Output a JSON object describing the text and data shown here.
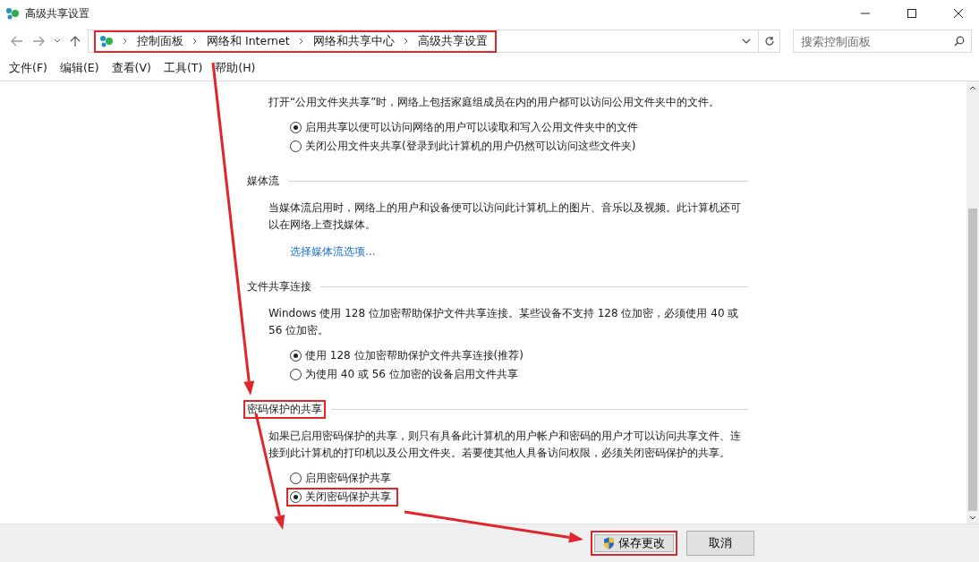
{
  "window": {
    "title": "高级共享设置"
  },
  "address_bar": {
    "highlighted": true,
    "crumbs": [
      "控制面板",
      "网络和 Internet",
      "网络和共享中心",
      "高级共享设置"
    ]
  },
  "search": {
    "placeholder": "搜索控制面板"
  },
  "menu": [
    "文件(F)",
    "编辑(E)",
    "查看(V)",
    "工具(T)",
    "帮助(H)"
  ],
  "sections": [
    {
      "items": [
        {
          "kind": "text",
          "text": "打开“公用文件夹共享”时，网络上包括家庭组成员在内的用户都可以访问公用文件夹中的文件。"
        },
        {
          "kind": "radio",
          "label": "启用共享以便可以访问网络的用户可以读取和写入公用文件夹中的文件",
          "selected": true,
          "highlighted": false
        },
        {
          "kind": "radio",
          "label": "关闭公用文件夹共享(登录到此计算机的用户仍然可以访问这些文件夹)",
          "selected": false,
          "highlighted": false
        }
      ]
    },
    {
      "heading": "媒体流",
      "heading_highlighted": false,
      "items": [
        {
          "kind": "text",
          "text": "当媒体流启用时，网络上的用户和设备便可以访问此计算机上的图片、音乐以及视频。此计算机还可以在网络上查找媒体。"
        },
        {
          "kind": "link",
          "text": "选择媒体流选项..."
        }
      ]
    },
    {
      "heading": "文件共享连接",
      "heading_highlighted": false,
      "items": [
        {
          "kind": "text",
          "text": "Windows 使用 128 位加密帮助保护文件共享连接。某些设备不支持 128 位加密，必须使用 40 或 56 位加密。"
        },
        {
          "kind": "radio",
          "label": "使用 128 位加密帮助保护文件共享连接(推荐)",
          "selected": true,
          "highlighted": false
        },
        {
          "kind": "radio",
          "label": "为使用 40 或 56 位加密的设备启用文件共享",
          "selected": false,
          "highlighted": false
        }
      ]
    },
    {
      "heading": "密码保护的共享",
      "heading_highlighted": true,
      "items": [
        {
          "kind": "text",
          "text": "如果已启用密码保护的共享，则只有具备此计算机的用户帐户和密码的用户才可以访问共享文件、连接到此计算机的打印机以及公用文件夹。若要使其他人具备访问权限，必须关闭密码保护的共享。"
        },
        {
          "kind": "radio",
          "label": "启用密码保护共享",
          "selected": false,
          "highlighted": false
        },
        {
          "kind": "radio",
          "label": "关闭密码保护共享",
          "selected": true,
          "highlighted": true
        }
      ]
    }
  ],
  "buttons": [
    {
      "label": "保存更改",
      "kind": "shield",
      "highlighted": true
    },
    {
      "label": "取消",
      "kind": "plain",
      "highlighted": false
    }
  ]
}
